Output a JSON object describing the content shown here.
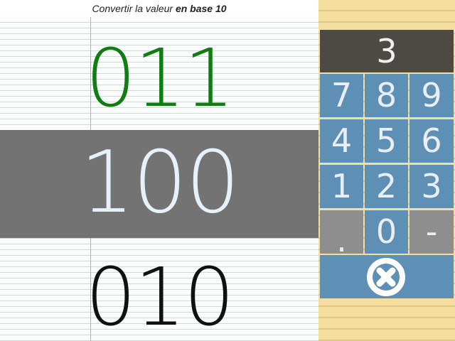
{
  "instruction": {
    "prefix": "Convertir la valeur ",
    "emphasis": "en base 10"
  },
  "numbers": {
    "previous": "011",
    "current": "100",
    "next": "010"
  },
  "keypad": {
    "display_value": "3",
    "keys": [
      "7",
      "8",
      "9",
      "4",
      "5",
      "6",
      "1",
      "2",
      "3",
      ".",
      "0",
      "-"
    ],
    "clear_icon": "close-circle-icon"
  },
  "colors": {
    "previous_number": "#0f7d0f",
    "current_number": "#e6f1fb",
    "next_number": "#111111",
    "active_band": "#727372",
    "key_blue": "#5e8fb4",
    "key_gray": "#8e8e8e",
    "display_bg": "#4d4a44",
    "panel_bg": "#f4dea0"
  }
}
